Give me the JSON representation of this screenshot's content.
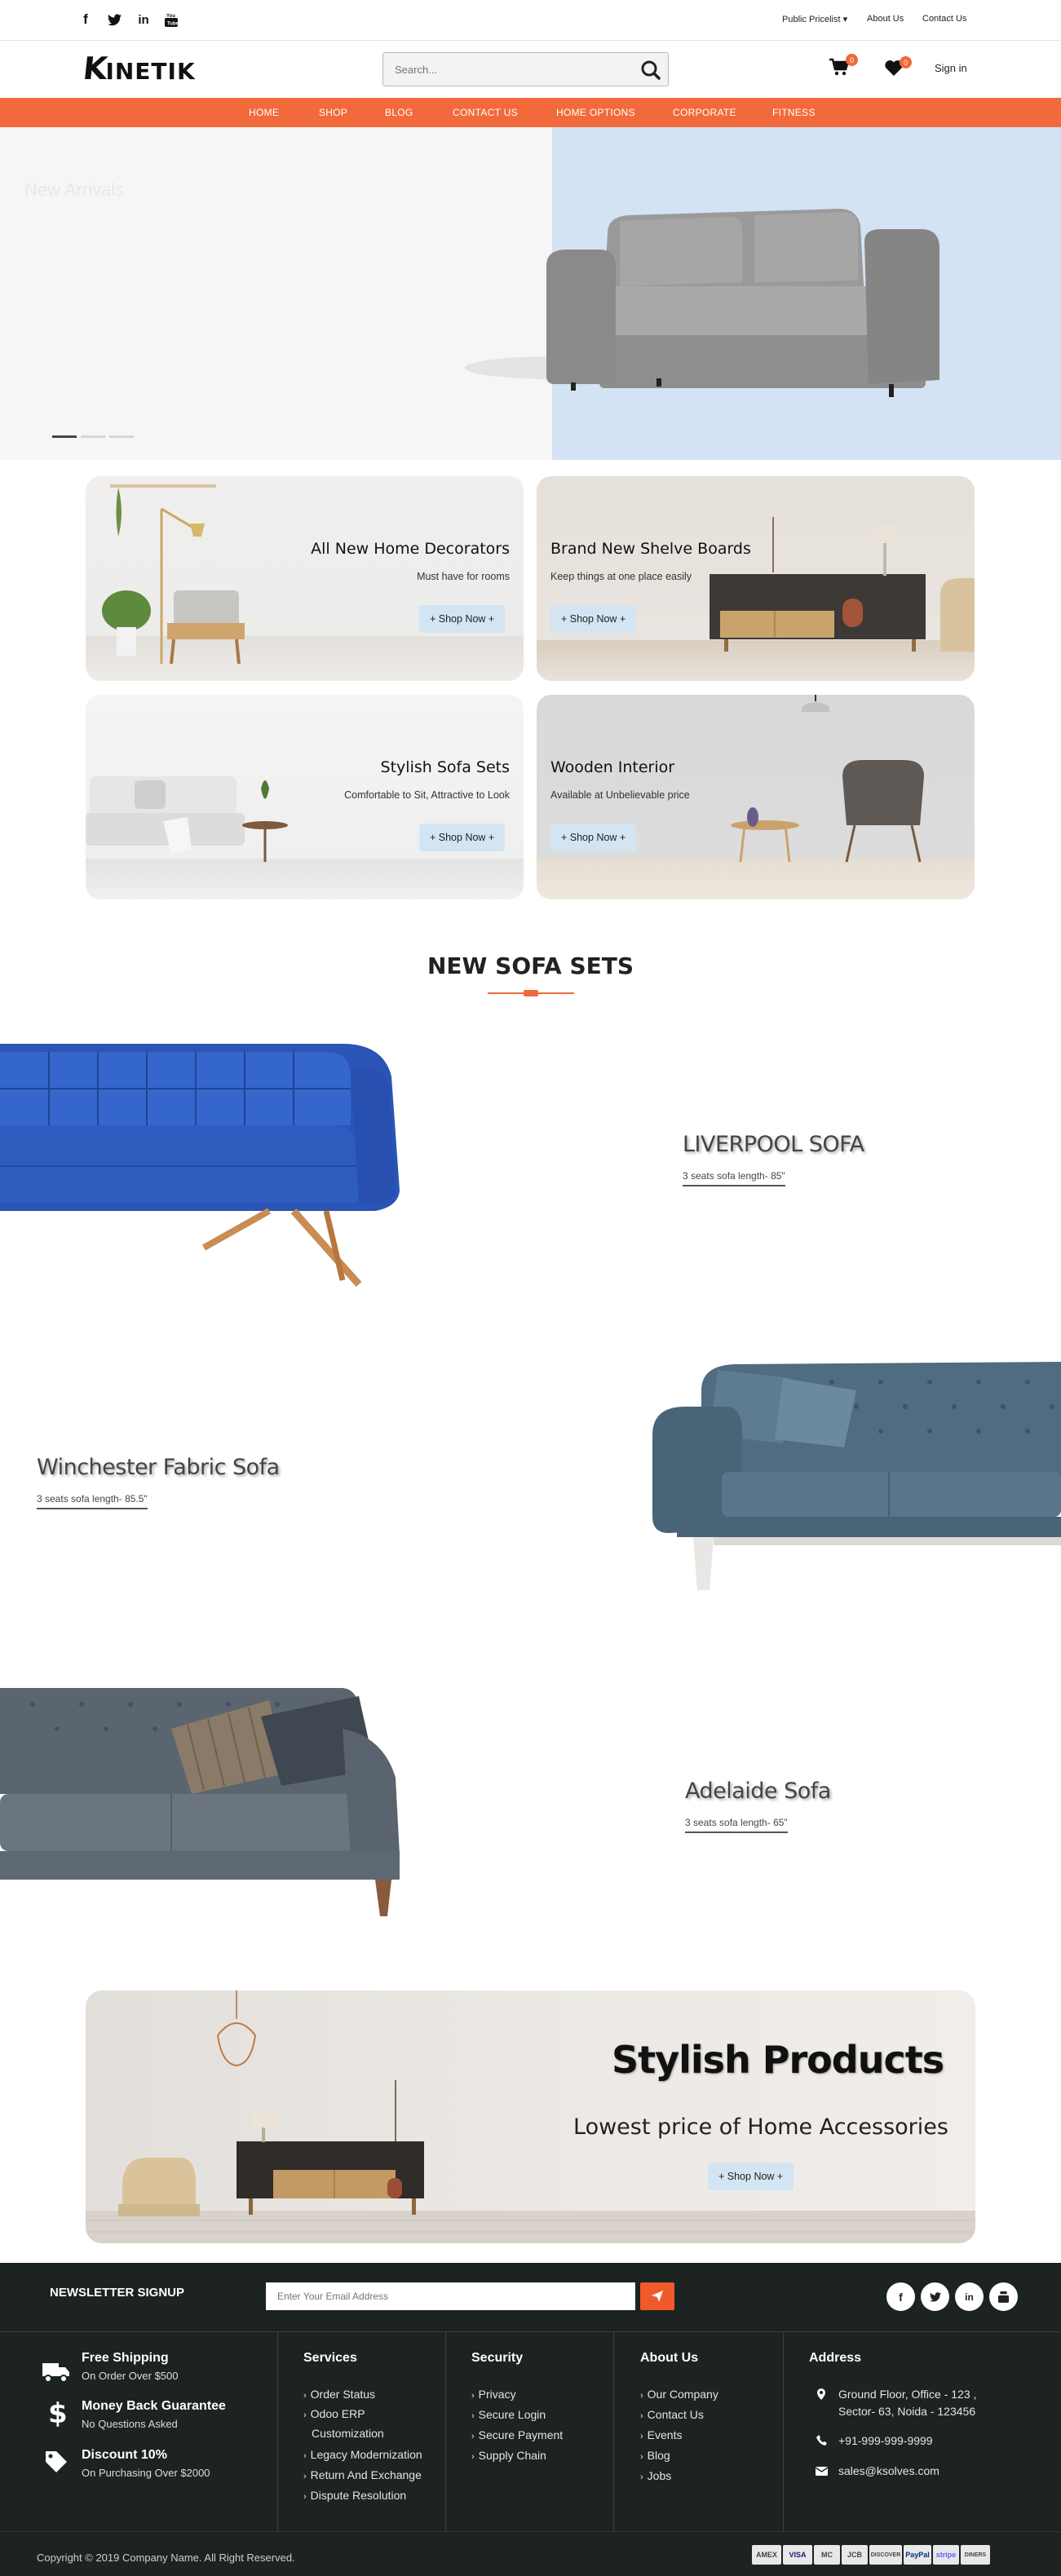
{
  "topbar": {
    "social": [
      "facebook-icon",
      "twitter-icon",
      "linkedin-icon",
      "youtube-icon"
    ],
    "links": {
      "pricelist": "Public Pricelist ▾",
      "about": "About Us",
      "contact": "Contact Us"
    }
  },
  "header": {
    "logo_k": "K",
    "logo_rest": "INETIK",
    "search_placeholder": "Search...",
    "cart_count": "0",
    "wishlist_count": "0",
    "signin": "Sign in"
  },
  "nav": [
    "HOME",
    "SHOP",
    "BLOG",
    "CONTACT US",
    "HOME OPTIONS",
    "CORPORATE",
    "FITNESS"
  ],
  "hero": {
    "ghost_text": "New Arrivals",
    "slides": 3,
    "active_slide": 1
  },
  "promos": [
    {
      "title": "All New Home Decorators",
      "subtitle": "Must have for rooms",
      "button": "+ Shop Now +"
    },
    {
      "title": "Brand New Shelve Boards",
      "subtitle": "Keep things at one place easily",
      "button": "+ Shop Now +"
    },
    {
      "title": "Stylish Sofa Sets",
      "subtitle": "Comfortable to Sit, Attractive to Look",
      "button": "+ Shop Now +"
    },
    {
      "title": "Wooden Interior",
      "subtitle": "Available at Unbelievable price",
      "button": "+ Shop Now +"
    }
  ],
  "sofa_section": {
    "title": "NEW SOFA SETS",
    "items": [
      {
        "name": "LIVERPOOL SOFA",
        "sub": "3 seats sofa length- 85\""
      },
      {
        "name": "Winchester Fabric Sofa",
        "sub": "3 seats sofa length- 85.5\""
      },
      {
        "name": "Adelaide Sofa",
        "sub": "3 seats sofa length- 65\""
      }
    ]
  },
  "banner": {
    "title": "Stylish Products",
    "subtitle": "Lowest price of Home Accessories",
    "button": "+ Shop Now +"
  },
  "footer": {
    "newsletter_title": "NEWSLETTER SIGNUP",
    "newsletter_placeholder": "Enter Your Email Address",
    "social": [
      "facebook-icon",
      "twitter-icon",
      "linkedin-icon",
      "youtube-icon"
    ],
    "features": [
      {
        "title": "Free Shipping",
        "sub": "On Order Over $500",
        "icon": "truck-icon"
      },
      {
        "title": "Money Back Guarantee",
        "sub": "No Questions Asked",
        "icon": "dollar-icon"
      },
      {
        "title": "Discount 10%",
        "sub": "On Purchasing Over $2000",
        "icon": "tag-icon"
      }
    ],
    "services": {
      "title": "Services",
      "items": [
        "Order Status",
        "Odoo ERP",
        "Customization",
        "Legacy Modernization",
        "Return And Exchange",
        "Dispute Resolution"
      ]
    },
    "security": {
      "title": "Security",
      "items": [
        "Privacy",
        "Secure Login",
        "Secure Payment",
        "Supply Chain"
      ]
    },
    "about": {
      "title": "About Us",
      "items": [
        "Our Company",
        "Contact Us",
        "Events",
        "Blog",
        "Jobs"
      ]
    },
    "address": {
      "title": "Address",
      "line1": "Ground Floor, Office - 123 ,",
      "line2": "Sector- 63, Noida - 123456",
      "phone": "+91-999-999-9999",
      "email": "sales@ksolves.com"
    },
    "copyright": "Copyright © 2019 Company Name. All Right Reserved.",
    "payments": [
      "AMEX",
      "VISA",
      "MC",
      "JCB",
      "DISCOVER",
      "PayPal",
      "stripe",
      "DINERS"
    ]
  },
  "colors": {
    "accent": "#f26a3c",
    "footer_bg": "#1c2321",
    "button_bg": "#d3e5f2",
    "hero_blue": "#d3e3f4"
  }
}
